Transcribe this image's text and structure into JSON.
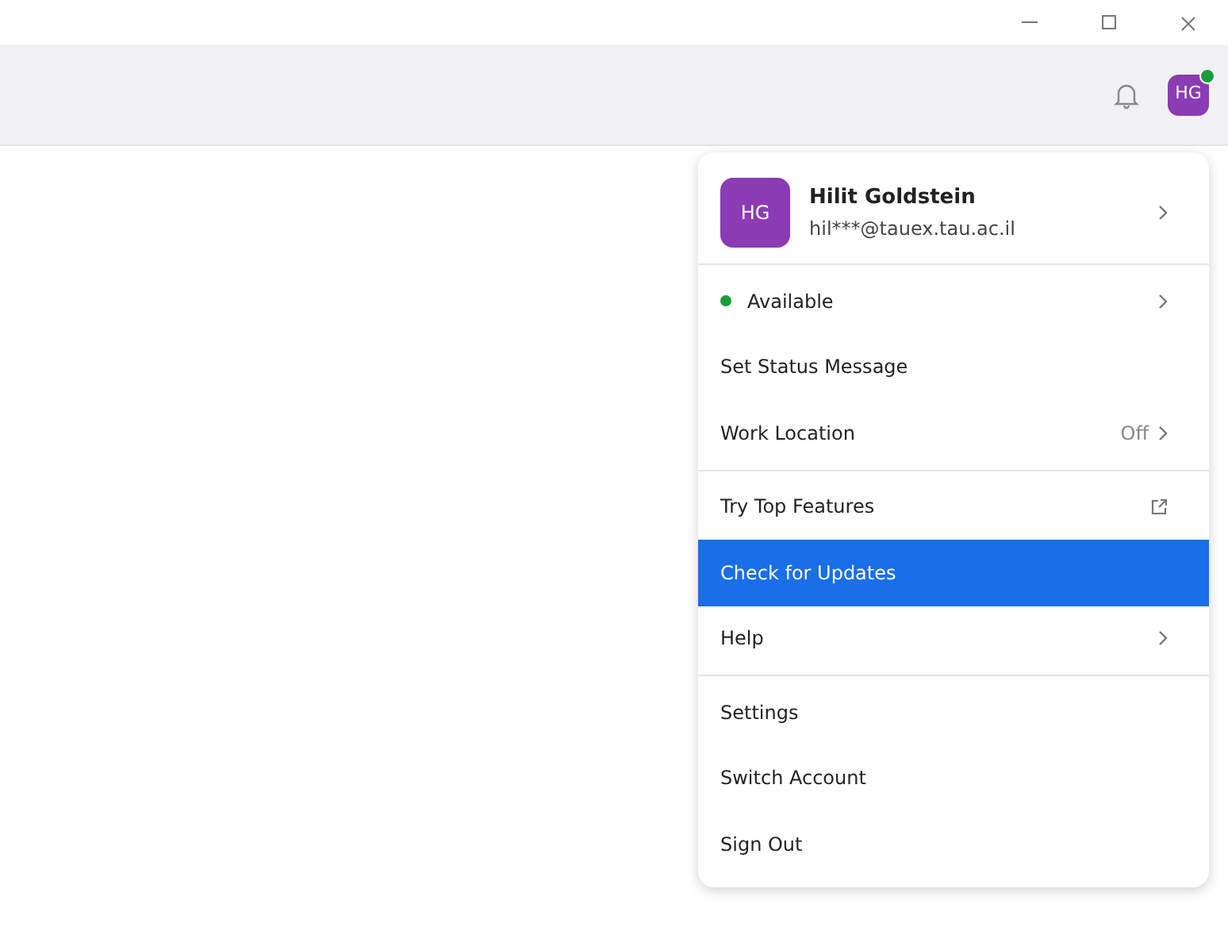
{
  "toolbar": {
    "avatar": {
      "initials": "HG",
      "online": true
    }
  },
  "menu": {
    "profile": {
      "initials": "HG",
      "name": "Hilit Goldstein",
      "email": "hil***@tauex.tau.ac.il"
    },
    "sections": [
      [
        {
          "kind": "submenu",
          "label": "Available",
          "color": "#1a9e3a",
          "selected": false
        },
        {
          "kind": "action",
          "label": "Set Status Message",
          "selected": false
        },
        {
          "kind": "submenu",
          "label": "Work Location",
          "value": "Off",
          "selected": false
        }
      ],
      [
        {
          "kind": "external",
          "label": "Try Top Features",
          "selected": false
        },
        {
          "kind": "action",
          "label": "Check for Updates",
          "selected": true
        },
        {
          "kind": "submenu",
          "label": "Help",
          "selected": false
        }
      ],
      [
        {
          "kind": "action",
          "label": "Settings",
          "selected": false
        },
        {
          "kind": "action",
          "label": "Switch Account",
          "selected": false
        },
        {
          "kind": "action",
          "label": "Sign Out",
          "selected": false
        }
      ]
    ]
  }
}
